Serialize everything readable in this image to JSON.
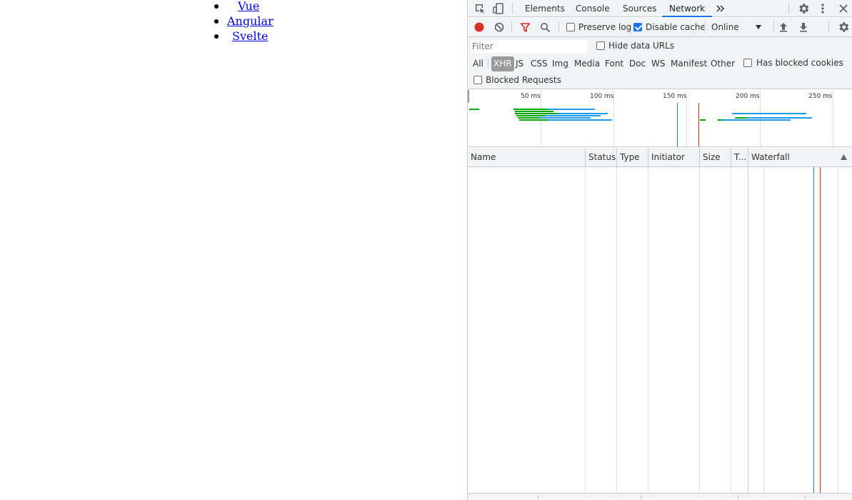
{
  "page": {
    "links": [
      "Vue",
      "Angular",
      "Svelte"
    ]
  },
  "devtools": {
    "tabs": [
      "Elements",
      "Console",
      "Sources",
      "Network"
    ],
    "active_tab": "Network",
    "toolbar": {
      "preserve_log_label": "Preserve log",
      "preserve_log_checked": false,
      "disable_cache_label": "Disable cache",
      "disable_cache_checked": true,
      "throttling_value": "Online"
    },
    "filter": {
      "placeholder": "Filter",
      "value": "",
      "hide_data_urls_label": "Hide data URLs",
      "types": [
        "All",
        "XHR",
        "JS",
        "CSS",
        "Img",
        "Media",
        "Font",
        "Doc",
        "WS",
        "Manifest",
        "Other"
      ],
      "active_type": "XHR",
      "has_blocked_cookies_label": "Has blocked cookies",
      "blocked_requests_label": "Blocked Requests"
    },
    "overview": {
      "ticks": [
        "50 ms",
        "100 ms",
        "150 ms",
        "200 ms",
        "250 ms"
      ],
      "dom_content_loaded_color": "#1a73e8",
      "load_color": "#d93025",
      "request_colors": {
        "waiting": "#00a600",
        "download": "#1a9be8"
      }
    },
    "table": {
      "columns": [
        "Name",
        "Status",
        "Type",
        "Initiator",
        "Size",
        "T...",
        "Waterfall"
      ]
    },
    "colors": {
      "record": "#d93025",
      "accent": "#1a73e8",
      "toolbar_bg": "#f1f3f4"
    },
    "icons": [
      "inspect-element-icon",
      "device-toolbar-icon",
      "more-tabs-icon",
      "settings-icon",
      "kebab-menu-icon",
      "close-icon",
      "record-icon",
      "clear-icon",
      "filter-icon",
      "search-icon",
      "import-har-icon",
      "export-har-icon",
      "network-settings-icon",
      "sort-ascending-icon"
    ]
  }
}
